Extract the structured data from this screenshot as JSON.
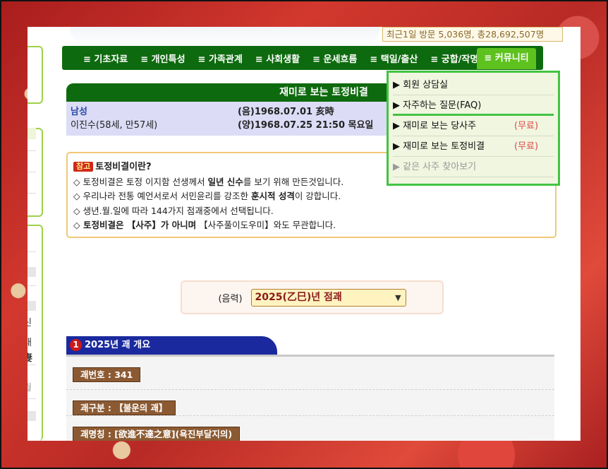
{
  "visitors": "최근1일 방문 5,036명, 총28,692,507명",
  "nav": {
    "items": [
      "≡ 기초자료",
      "≡ 개인특성",
      "≡ 가족관계",
      "≡ 사회생활",
      "≡ 운세흐름",
      "≡ 택일/출산",
      "≡ 궁합/작명"
    ],
    "active": "≡ 커뮤니티"
  },
  "title": "재미로 보는 토정비결",
  "person": {
    "gender": "남성",
    "name_age": "이진수(58세, 만57세)",
    "lunar": "(음)1968.07.01 亥時",
    "solar": "(양)1968.07.25 21:50 목요일"
  },
  "info": {
    "badge": "참고",
    "heading": "토정비결이란?",
    "line1_a": "◇ 토정비결은 토정 이지함 선생께서 ",
    "line1_b": "일년 신수",
    "line1_c": "를 보기 위해 만든것입니다.",
    "line2_a": "◇ 우리나라 전통 예언서로서 서민윤리를 강조한 ",
    "line2_b": "훈시적 성격",
    "line2_c": "이 강합니다.",
    "line3": "◇ 생년.월.일에 따라 144가지 점괘중에서 선택됩니다.",
    "line4_a": "◇ 토정비결은 【사주】가 아니며",
    "line4_b": " 【사주풀이도우미】와도 무관합니다."
  },
  "select": {
    "label": "(음력)",
    "value": "2025(乙巳)년 점괘"
  },
  "section": {
    "number": "1",
    "title": "2025년 괘 개요"
  },
  "rows": [
    "괘번호 : 341",
    "괘구분 : 【불운의 괘】",
    "괘명칭 : [欲進不達之意](욕진부달지의)"
  ],
  "dropdown": {
    "items": [
      {
        "label": "▶ 회원 상담실",
        "free": ""
      },
      {
        "label": "▶ 자주하는 질문(FAQ)",
        "free": ""
      },
      {
        "label": "▶ 재미로 보는 당사주",
        "free": "(무료)"
      },
      {
        "label": "▶ 재미로 보는 토정비결",
        "free": "(무료)"
      },
      {
        "label": "▶ 같은 사주 찾아보기",
        "free": ""
      }
    ]
  },
  "left_fragments": [
    "신",
    "재",
    "妻",
    "월"
  ],
  "left_top_char": "|"
}
